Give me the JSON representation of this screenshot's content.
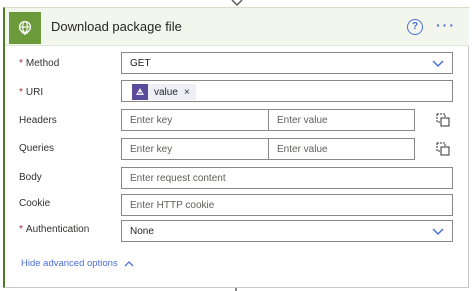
{
  "action": {
    "title": "Download package file",
    "help_icon": "help-circle-icon",
    "more_icon": "more-options-icon",
    "help_glyph": "?",
    "more_glyph": "···"
  },
  "fields": {
    "method": {
      "label": "Method",
      "value": "GET",
      "required": true
    },
    "uri": {
      "label": "URI",
      "token": "value",
      "token_remove": "×",
      "required": true
    },
    "headers": {
      "label": "Headers",
      "key_placeholder": "Enter key",
      "value_placeholder": "Enter value"
    },
    "queries": {
      "label": "Queries",
      "key_placeholder": "Enter key",
      "value_placeholder": "Enter value"
    },
    "body": {
      "label": "Body",
      "placeholder": "Enter request content"
    },
    "cookie": {
      "label": "Cookie",
      "placeholder": "Enter HTTP cookie"
    },
    "authentication": {
      "label": "Authentication",
      "value": "None",
      "required": true
    }
  },
  "required_marker": "*",
  "advanced_toggle": "Hide advanced options",
  "colors": {
    "accent": "#4a6fd6",
    "header_icon_bg": "#6a9a3a",
    "token_icon_bg": "#5b4a9a",
    "required": "#a4262c"
  }
}
